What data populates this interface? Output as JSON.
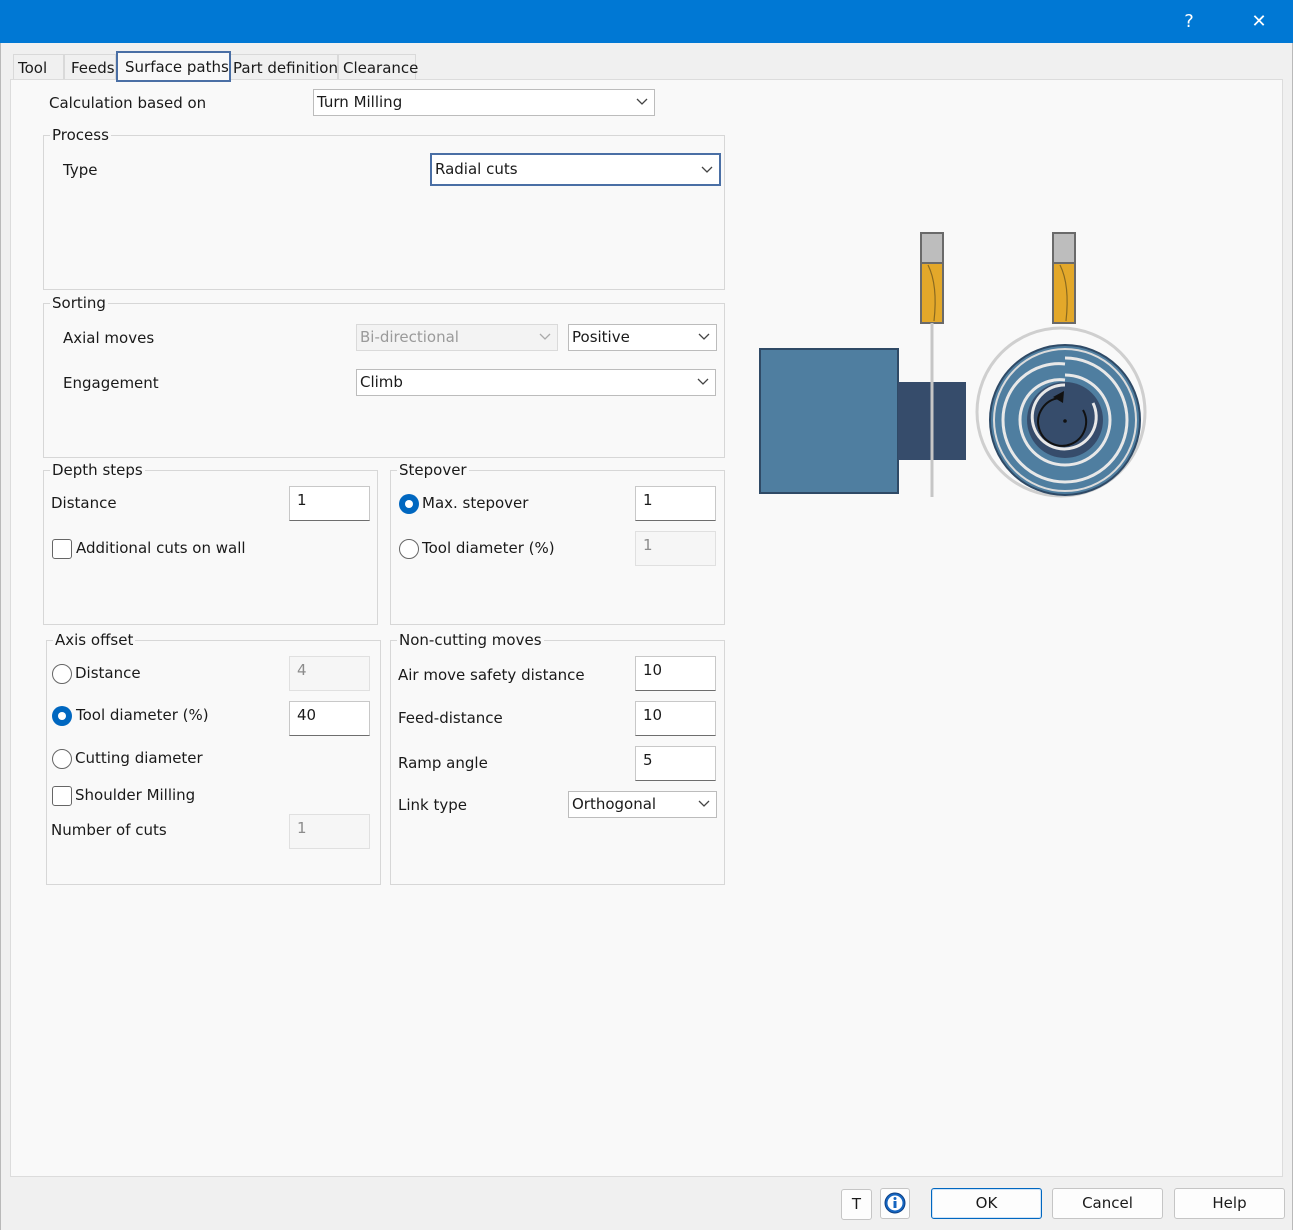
{
  "titlebar": {
    "help_glyph": "?",
    "close_glyph": "✕"
  },
  "tabs": [
    {
      "label": "Tool"
    },
    {
      "label": "Feeds"
    },
    {
      "label": "Surface paths",
      "active": true
    },
    {
      "label": "Part definition"
    },
    {
      "label": "Clearance"
    }
  ],
  "calculation": {
    "label": "Calculation based on",
    "value": "Turn Milling"
  },
  "process": {
    "title": "Process",
    "type_label": "Type",
    "type_value": "Radial cuts"
  },
  "sorting": {
    "title": "Sorting",
    "axial_label": "Axial moves",
    "axial_direction": "Bi-directional",
    "axial_sign": "Positive",
    "engagement_label": "Engagement",
    "engagement_value": "Climb"
  },
  "depth_steps": {
    "title": "Depth steps",
    "distance_label": "Distance",
    "distance_value": "1",
    "additional_cuts_label": "Additional cuts on wall",
    "additional_cuts_checked": false
  },
  "stepover": {
    "title": "Stepover",
    "max_label": "Max. stepover",
    "max_value": "1",
    "max_selected": true,
    "tool_diam_label": "Tool diameter (%)",
    "tool_diam_value": "1"
  },
  "axis_offset": {
    "title": "Axis offset",
    "distance_label": "Distance",
    "distance_value": "4",
    "tool_diam_label": "Tool diameter (%)",
    "tool_diam_value": "40",
    "tool_diam_selected": true,
    "cutting_diam_label": "Cutting diameter",
    "shoulder_label": "Shoulder Milling",
    "shoulder_checked": false,
    "num_cuts_label": "Number of cuts",
    "num_cuts_value": "1"
  },
  "non_cutting": {
    "title": "Non-cutting moves",
    "air_label": "Air move safety distance",
    "air_value": "10",
    "feed_label": "Feed-distance",
    "feed_value": "10",
    "ramp_label": "Ramp angle",
    "ramp_value": "5",
    "link_label": "Link type",
    "link_value": "Orthogonal"
  },
  "footer": {
    "t_button": "T",
    "info_icon": "info-icon",
    "ok": "OK",
    "cancel": "Cancel",
    "help": "Help"
  },
  "colors": {
    "titlebar": "#0078d4",
    "accent": "#0067c0",
    "focus_border": "#4a6fa5",
    "part_body": "#4f7ea0",
    "part_dark": "#364c6b",
    "tool_gold": "#e3a82a"
  }
}
